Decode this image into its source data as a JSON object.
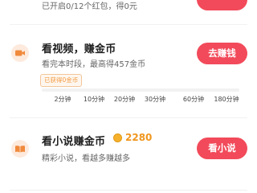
{
  "top_partial": {
    "desc": "已开启0/12个红包，得0元"
  },
  "video_task": {
    "icon": "video-camera-icon",
    "title": "看视频，赚金币",
    "desc": "看完本时段，最高得457金币",
    "button": "去赚钱",
    "earned": "已获得0金币",
    "progress": 0,
    "milestones": [
      "2分钟",
      "10分钟",
      "20分钟",
      "30分钟",
      "60分钟",
      "180分钟"
    ]
  },
  "novel_task": {
    "icon": "book-icon",
    "title": "看小说赚金币",
    "coin_icon": "coin-icon",
    "coin_value": "2280",
    "desc": "精彩小说，看越多赚越多",
    "button": "看小说"
  },
  "colors": {
    "accent": "#f24a5a",
    "icon_bg": "#fdeadd",
    "icon_fg": "#f08a3c",
    "coin": "#f0961e"
  }
}
